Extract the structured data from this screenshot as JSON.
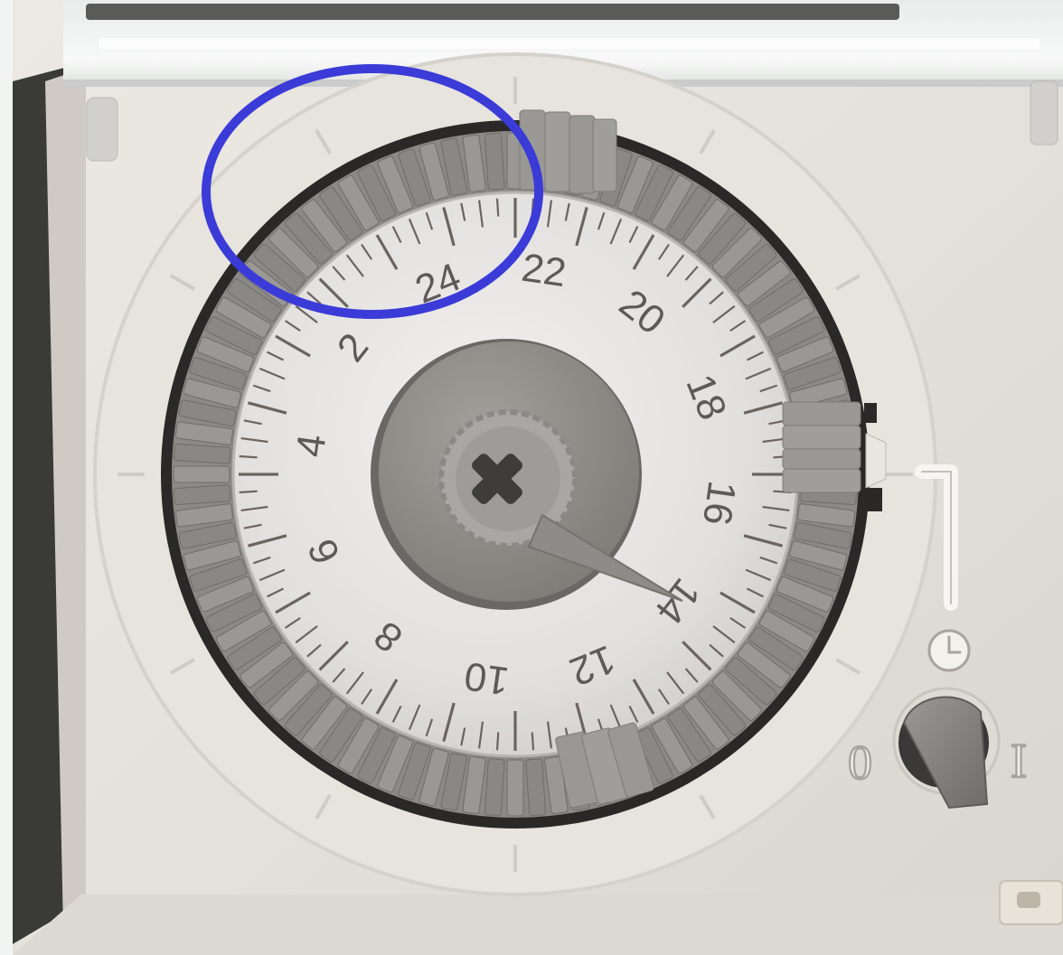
{
  "timer": {
    "hour_labels": [
      "2",
      "4",
      "6",
      "8",
      "10",
      "12",
      "14",
      "16",
      "18",
      "20",
      "22",
      "24"
    ],
    "switch_labels": {
      "off": "0",
      "on": "I"
    },
    "mode_icon": "clock-icon",
    "annotation_color": "#3b3bd8"
  }
}
